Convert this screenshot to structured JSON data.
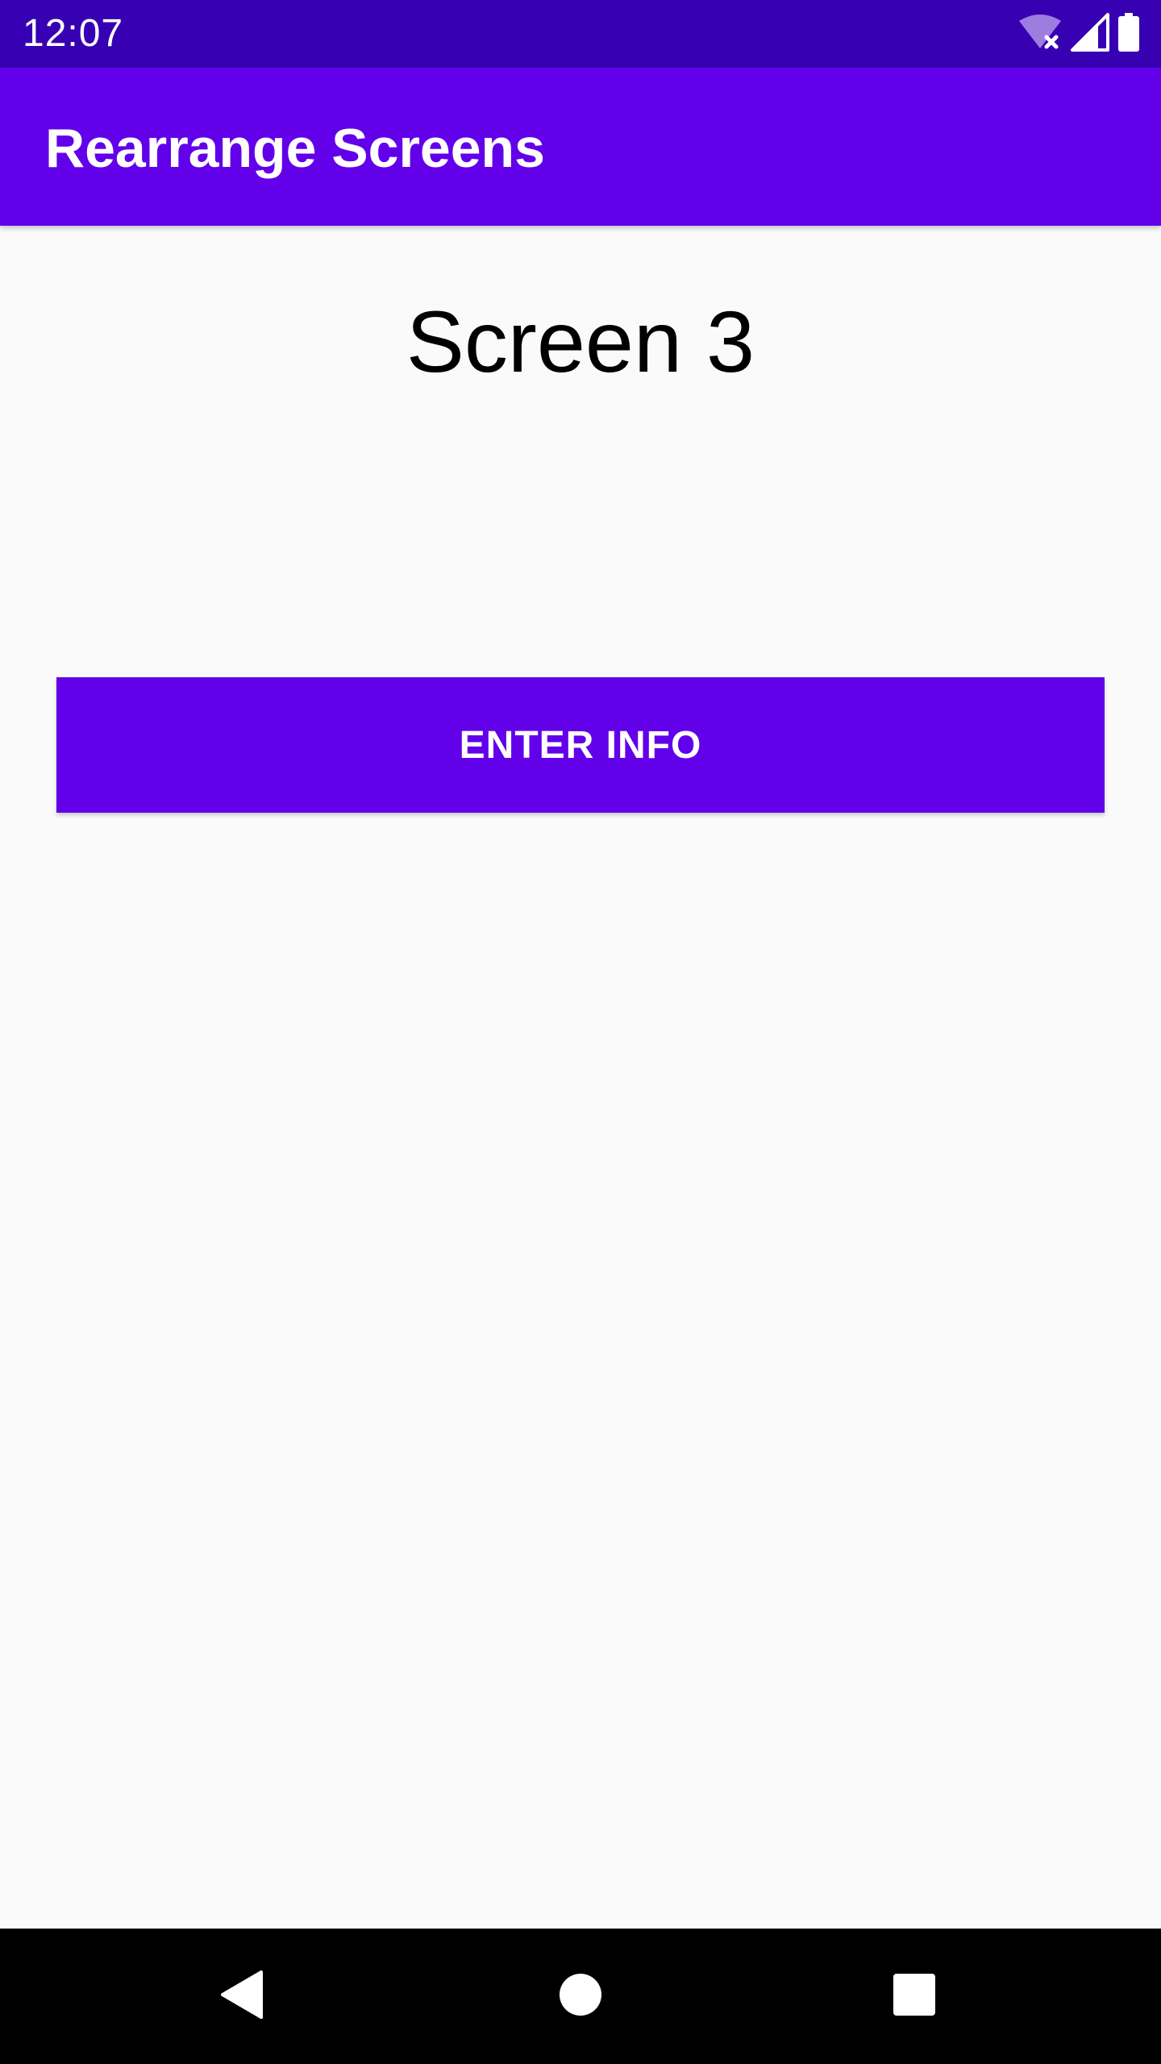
{
  "status_bar": {
    "time": "12:07",
    "icons": [
      "wifi-off-icon",
      "cellular-signal-icon",
      "battery-icon"
    ]
  },
  "app_bar": {
    "title": "Rearrange Screens"
  },
  "main": {
    "heading": "Screen 3",
    "button_label": "ENTER INFO"
  },
  "nav_bar": {
    "buttons": [
      "back-icon",
      "home-icon",
      "recents-icon"
    ]
  },
  "colors": {
    "status_bar": "#3700b3",
    "primary": "#6200ea",
    "background": "#fafafa",
    "nav_bar": "#000000"
  }
}
